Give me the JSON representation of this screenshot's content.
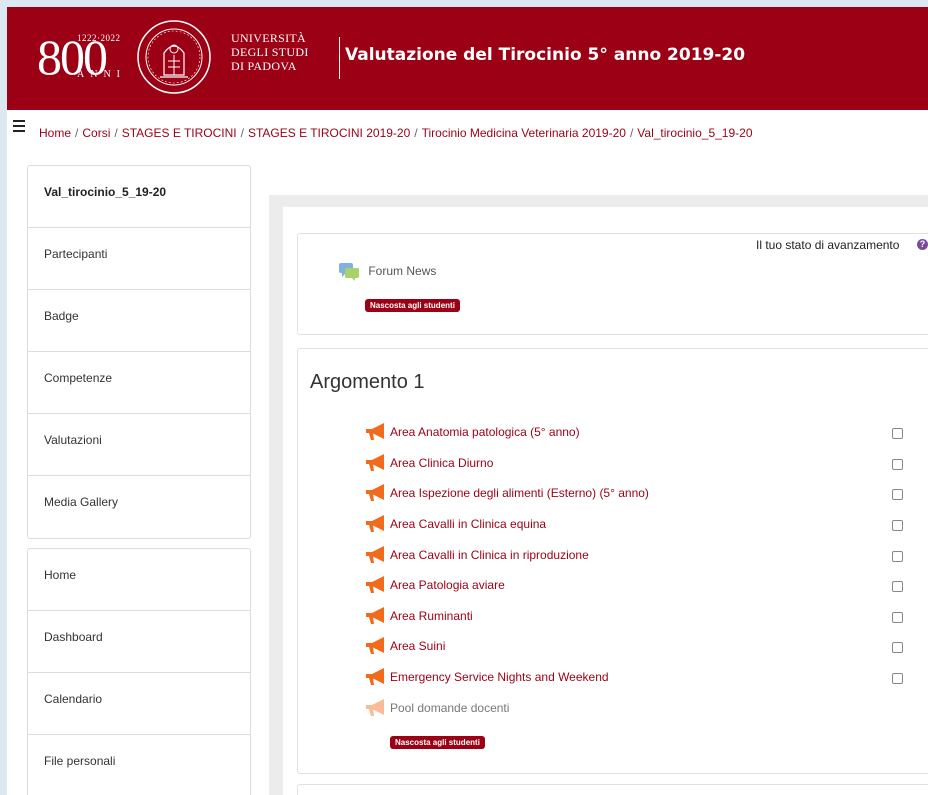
{
  "header": {
    "logo_number": "800",
    "logo_years": "1222·2022",
    "logo_anni": "ANNI",
    "university_lines": [
      "UNIVERSITÀ",
      "DEGLI STUDI",
      "DI PADOVA"
    ],
    "course_title": "Valutazione del Tirocinio 5° anno 2019-20",
    "brand_color": "#9b0014"
  },
  "breadcrumb": [
    "Home",
    "Corsi",
    "STAGES E TIROCINI",
    "STAGES E TIROCINI 2019-20",
    "Tirocinio Medicina Veterinaria 2019-20",
    "Val_tirocinio_5_19-20"
  ],
  "breadcrumb_separator": "/",
  "sidebar": {
    "course_nav": [
      "Val_tirocinio_5_19-20",
      "Partecipanti",
      "Badge",
      "Competenze",
      "Valutazioni",
      "Media Gallery"
    ],
    "site_nav": [
      "Home",
      "Dashboard",
      "Calendario",
      "File personali"
    ]
  },
  "main": {
    "progress_label": "Il tuo stato di avanzamento",
    "help_icon": "question-circle-icon",
    "forum": {
      "label": "Forum News",
      "badge": "Nascosta agli studenti"
    },
    "section": {
      "title": "Argomento 1",
      "activities": [
        {
          "label": "Area Anatomia patologica (5° anno)",
          "hidden": false
        },
        {
          "label": "Area Clinica Diurno",
          "hidden": false
        },
        {
          "label": "Area Ispezione degli alimenti (Esterno) (5° anno)",
          "hidden": false
        },
        {
          "label": "Area Cavalli in Clinica equina",
          "hidden": false
        },
        {
          "label": "Area Cavalli in Clinica in riproduzione",
          "hidden": false
        },
        {
          "label": "Area Patologia aviare",
          "hidden": false
        },
        {
          "label": "Area Ruminanti",
          "hidden": false
        },
        {
          "label": "Area Suini",
          "hidden": false
        },
        {
          "label": "Emergency Service Nights and Weekend",
          "hidden": false
        },
        {
          "label": "Pool domande docenti",
          "hidden": true
        }
      ],
      "hidden_badge": "Nascosta agli studenti"
    }
  }
}
